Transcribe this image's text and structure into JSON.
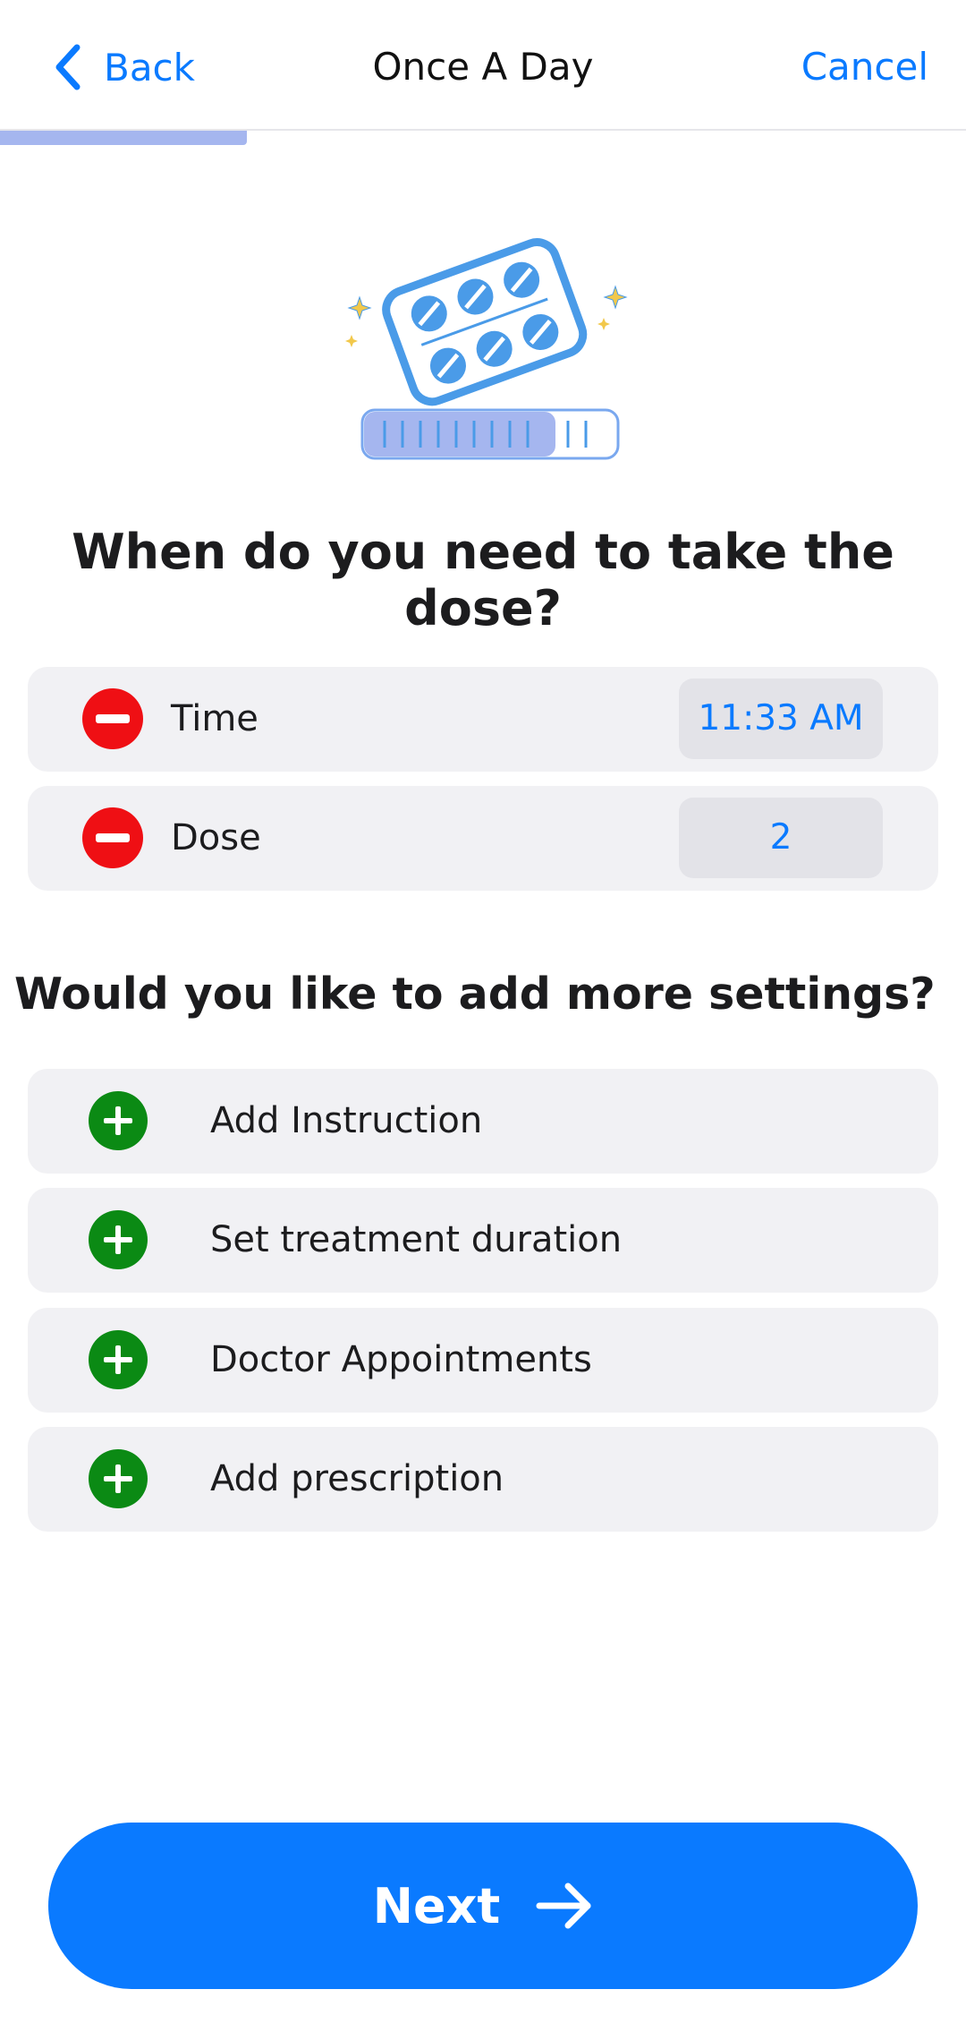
{
  "nav": {
    "back_label": "Back",
    "title": "Once A Day",
    "cancel_label": "Cancel"
  },
  "progress": {
    "fraction": 0.256
  },
  "illustration": {
    "icon": "pill-blister-pack-icon"
  },
  "dose_section": {
    "heading": "When do you need to take the dose?",
    "rows": [
      {
        "label": "Time",
        "value": "11:33 AM",
        "action_icon": "remove-minus-icon"
      },
      {
        "label": "Dose",
        "value": "2",
        "action_icon": "remove-minus-icon"
      }
    ]
  },
  "settings_section": {
    "heading": "Would you like to add more settings?",
    "items": [
      {
        "label": "Add Instruction",
        "icon": "add-plus-icon"
      },
      {
        "label": "Set treatment duration",
        "icon": "add-plus-icon"
      },
      {
        "label": "Doctor Appointments",
        "icon": "add-plus-icon"
      },
      {
        "label": "Add prescription",
        "icon": "add-plus-icon"
      }
    ]
  },
  "footer": {
    "next_label": "Next",
    "next_icon": "arrow-right-icon"
  },
  "colors": {
    "accent": "#0a7aff",
    "remove": "#ef0f14",
    "add": "#0b8a14",
    "progress": "#a5b6ef",
    "row_background": "#f1f1f4"
  }
}
